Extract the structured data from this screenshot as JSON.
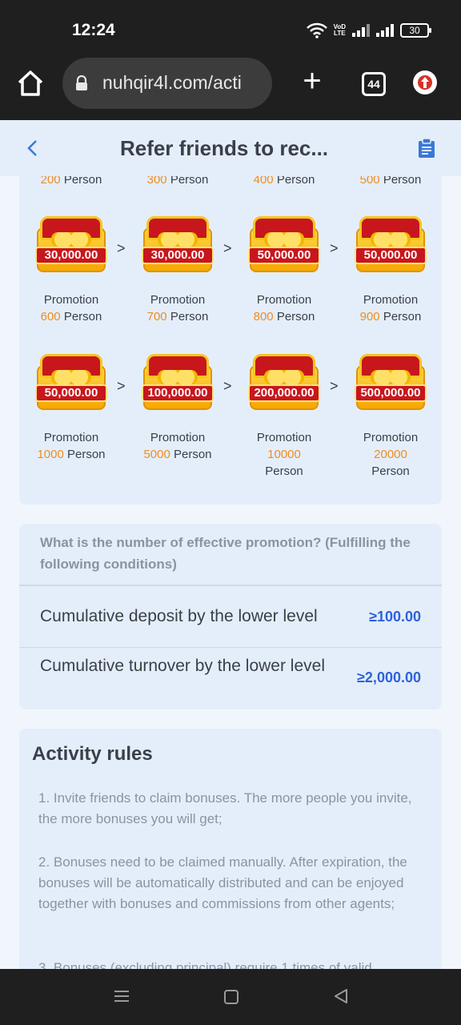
{
  "status_bar": {
    "time": "12:24",
    "volte_top": "VoD",
    "volte_bottom": "LTE",
    "battery": "30"
  },
  "browser": {
    "url": "nuhqir4l.com/acti",
    "tabs_count": "44"
  },
  "header": {
    "title": "Refer friends to rec..."
  },
  "tiers": [
    {
      "amount": "",
      "label": "",
      "num": "200",
      "person": "Person"
    },
    {
      "amount": "",
      "label": "",
      "num": "300",
      "person": "Person"
    },
    {
      "amount": "",
      "label": "",
      "num": "400",
      "person": "Person"
    },
    {
      "amount": "",
      "label": "",
      "num": "500",
      "person": "Person"
    },
    {
      "amount": "30,000.00",
      "label": "Promotion",
      "num": "600",
      "person": "Person"
    },
    {
      "amount": "30,000.00",
      "label": "Promotion",
      "num": "700",
      "person": "Person"
    },
    {
      "amount": "50,000.00",
      "label": "Promotion",
      "num": "800",
      "person": "Person"
    },
    {
      "amount": "50,000.00",
      "label": "Promotion",
      "num": "900",
      "person": "Person"
    },
    {
      "amount": "50,000.00",
      "label": "Promotion",
      "num": "1000",
      "person": "Person"
    },
    {
      "amount": "100,000.00",
      "label": "Promotion",
      "num": "5000",
      "person": "Person"
    },
    {
      "amount": "200,000.00",
      "label": "Promotion",
      "num": "10000",
      "person": "Person"
    },
    {
      "amount": "500,000.00",
      "label": "Promotion",
      "num": "20000",
      "person": "Person"
    }
  ],
  "arrow_symbol": ">",
  "conditions": {
    "heading": "What is the number of effective promotion? (Fulfilling the following conditions)",
    "rows": [
      {
        "label": "Cumulative deposit by the lower level",
        "value": "≥100.00"
      },
      {
        "label": "Cumulative turnover by the lower level",
        "value": "≥2,000.00"
      }
    ]
  },
  "rules": {
    "title": "Activity rules",
    "items": [
      "1. Invite friends to claim bonuses. The more people you invite, the more bonuses you will get;",
      "2. Bonuses need to be claimed manually. After expiration, the bonuses will be automatically distributed and can be enjoyed together with bonuses and commissions from other agents;",
      "3. Bonuses (excluding principal) require 1 times of valid"
    ]
  },
  "colors": {
    "accent_blue": "#2d62db",
    "orange": "#f08c1f",
    "card_bg": "#e4eefa",
    "chest_red": "#c8161d",
    "chest_gold": "#f5a800"
  }
}
